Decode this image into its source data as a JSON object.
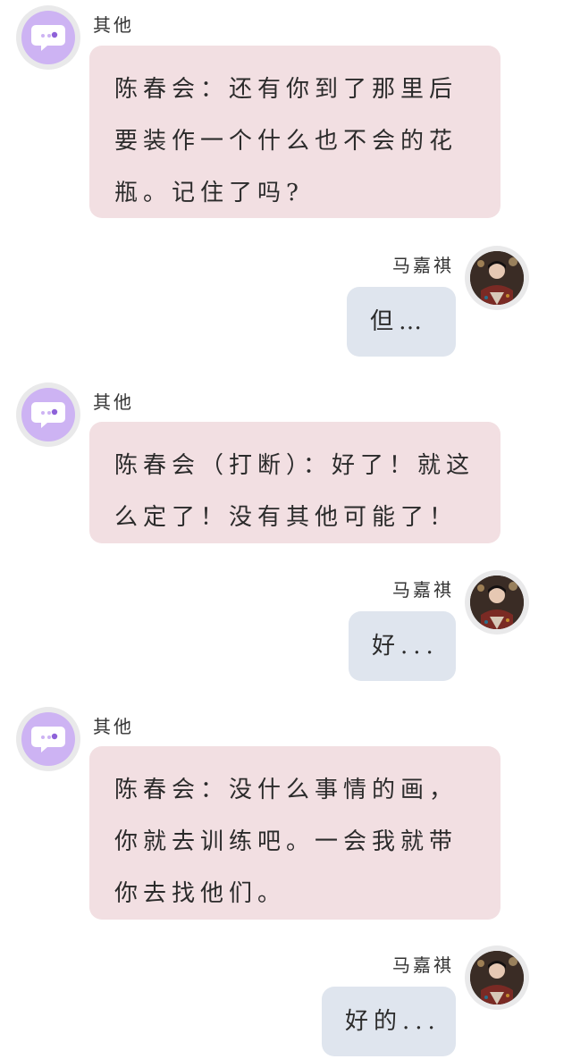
{
  "messages": [
    {
      "side": "other",
      "sender": "其他",
      "text": "陈春会：还有你到了那里后要装作一个什么也不会的花瓶。记住了吗?"
    },
    {
      "side": "me",
      "sender": "马嘉祺",
      "text": "但…"
    },
    {
      "side": "other",
      "sender": "其他",
      "text": "陈春会（打断）：好了！就这么定了！没有其他可能了！"
    },
    {
      "side": "me",
      "sender": "马嘉祺",
      "text": "好..."
    },
    {
      "side": "other",
      "sender": "其他",
      "text": "陈春会：没什么事情的画，你就去训练吧。一会我就带你去找他们。"
    },
    {
      "side": "me",
      "sender": "马嘉祺",
      "text": "好的..."
    }
  ],
  "icons": {
    "other_avatar": "chat-bubble-icon",
    "me_avatar": "user-photo"
  },
  "colors": {
    "other_bubble": "#f2dfe2",
    "me_bubble": "#dfe5ee",
    "other_avatar_bg": "#cdb3f3",
    "avatar_ring": "#e9e9ea"
  }
}
